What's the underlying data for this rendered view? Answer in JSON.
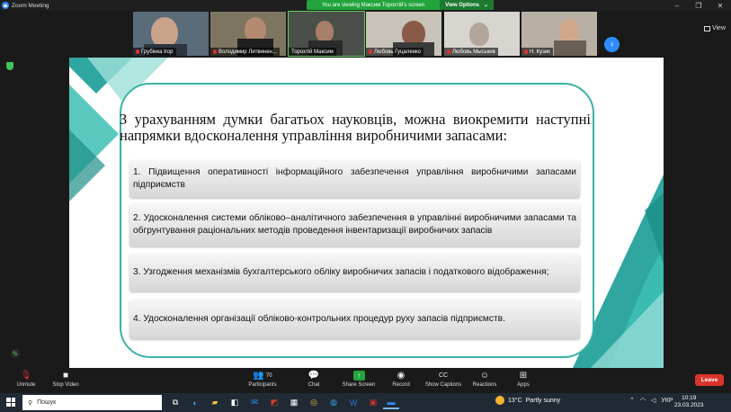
{
  "window": {
    "title": "Zoom Meeting"
  },
  "banner": {
    "message": "You are viewing Максим Торохтій's screen",
    "view_options": "View Options"
  },
  "gallery": {
    "participants": [
      {
        "name": "Грубінка Ігор",
        "muted": true
      },
      {
        "name": "Володимир Литвинен...",
        "muted": true
      },
      {
        "name": "Торохтій Максим",
        "muted": false
      },
      {
        "name": "Любовь Гуцаленко",
        "muted": true
      },
      {
        "name": "Любовь Мыськив",
        "muted": true
      },
      {
        "name": "Н. Кузик",
        "muted": true
      }
    ],
    "view_label": "View"
  },
  "slide": {
    "heading": "З урахуванням думки багатьох науковців, можна виокремити наступні напрямки вдосконалення управління виробничими запасами:",
    "items": [
      "1. Підвищення оперативності інформаційного забезпечення управління виробничими запасами підприємств",
      "2. Удосконалення системи обліково–аналітичного забезпечення в управлінні виробничими запасами та обгрунтування раціональних методів проведення інвентаризації виробничих запасів",
      "3. Узгодження механізмів бухгалтерського обліку виробничих запасів і податкового відображення;",
      "4. Удосконалення організації обліково-контрольних процедур руху запасів підприємств."
    ],
    "accent_color": "#39b3a5"
  },
  "toolbar": {
    "unmute": "Unmute",
    "stop_video": "Stop Video",
    "participants": "Participants",
    "participants_count": "70",
    "chat": "Chat",
    "share_screen": "Share Screen",
    "record": "Record",
    "show_captions": "Show Captions",
    "reactions": "Reactions",
    "apps": "Apps",
    "leave": "Leave"
  },
  "taskbar": {
    "search_placeholder": "Пошук",
    "weather_temp": "13°C",
    "weather_text": "Partly sunny",
    "language": "УКР",
    "time": "10:19",
    "date": "23.03.2023"
  },
  "colors": {
    "share_green": "#22a53c",
    "leave_red": "#d9342b",
    "zoom_blue": "#2d8cff"
  }
}
